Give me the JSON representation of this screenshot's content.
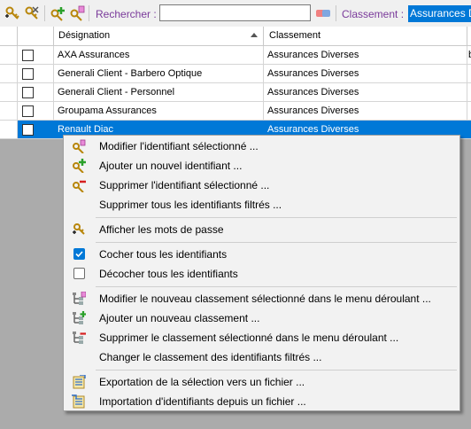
{
  "toolbar": {
    "search_label": "Rechercher :",
    "search_value": "",
    "classement_label": "Classement :",
    "classement_value": "Assurances Diverses"
  },
  "grid": {
    "columns": [
      "",
      "",
      "Désignation",
      "Classement",
      ""
    ],
    "rows": [
      {
        "designation": "AXA Assurances",
        "classement": "Assurances Diverses",
        "extra": "b"
      },
      {
        "designation": "Generali Client - Barbero Optique",
        "classement": "Assurances Diverses",
        "extra": ""
      },
      {
        "designation": "Generali Client - Personnel",
        "classement": "Assurances Diverses",
        "extra": ""
      },
      {
        "designation": "Groupama Assurances",
        "classement": "Assurances Diverses",
        "extra": ""
      },
      {
        "designation": "Renault Diac",
        "classement": "Assurances Diverses",
        "extra": ""
      }
    ]
  },
  "menu": {
    "items": [
      {
        "label": "Modifier l'identifiant sélectionné ...",
        "icon": "key-edit-icon"
      },
      {
        "label": "Ajouter un nouvel identifiant ...",
        "icon": "key-add-icon"
      },
      {
        "label": "Supprimer l'identifiant sélectionné ...",
        "icon": "key-remove-icon"
      },
      {
        "label": "Supprimer tous les identifiants filtrés ...",
        "icon": ""
      },
      {
        "label": "Afficher les mots de passe",
        "icon": "key-show-icon"
      },
      {
        "label": "Cocher tous les identifiants",
        "icon": "checkbox-checked-icon"
      },
      {
        "label": "Décocher tous les identifiants",
        "icon": "checkbox-unchecked-icon"
      },
      {
        "label": "Modifier le nouveau classement sélectionné dans le menu déroulant ...",
        "icon": "tree-edit-icon"
      },
      {
        "label": "Ajouter un nouveau classement ...",
        "icon": "tree-add-icon"
      },
      {
        "label": "Supprimer le classement sélectionné dans le menu déroulant ...",
        "icon": "tree-remove-icon"
      },
      {
        "label": "Changer le classement des identifiants filtrés ...",
        "icon": ""
      },
      {
        "label": "Exportation de la sélection vers un fichier ...",
        "icon": "export-icon"
      },
      {
        "label": "Importation d'identifiants depuis un fichier ...",
        "icon": "import-icon"
      }
    ]
  },
  "colors": {
    "selection": "#0078d7",
    "label_purple": "#7a3a9a"
  }
}
